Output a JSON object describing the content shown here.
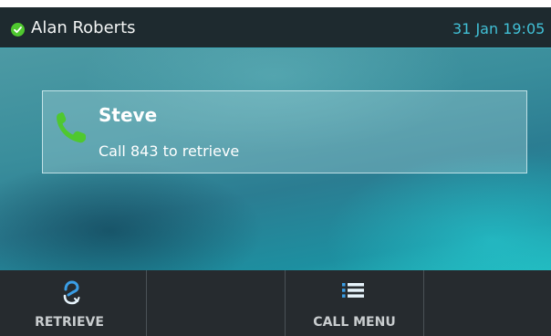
{
  "status_bar": {
    "user_name": "Alan Roberts",
    "presence_icon": "available-check-icon",
    "presence_color": "#4fc82f",
    "datetime": "31 Jan 19:05"
  },
  "parked_call": {
    "caller": "Steve",
    "instructions": "Call 843 to retrieve",
    "icon": "handset-icon",
    "icon_color": "#4fc82f"
  },
  "softkeys": [
    {
      "label": "RETRIEVE",
      "icon": "retrieve-icon"
    },
    {
      "label": "",
      "icon": ""
    },
    {
      "label": "CALL MENU",
      "icon": "list-menu-icon"
    },
    {
      "label": "",
      "icon": ""
    }
  ],
  "colors": {
    "status_bar_bg": "#1e2a2f",
    "datetime": "#41c0d6",
    "softkey_bar_bg": "#262b2f",
    "accent_blue": "#3a9ee6"
  }
}
